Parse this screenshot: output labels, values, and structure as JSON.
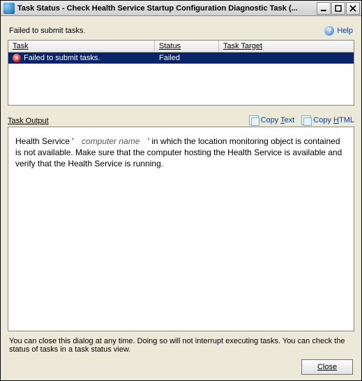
{
  "window": {
    "title": "Task Status - Check Health Service Startup Configuration Diagnostic Task (..."
  },
  "status_message": "Failed to submit tasks.",
  "help": {
    "label": "Help"
  },
  "table": {
    "columns": {
      "task": "Task",
      "status": "Status",
      "target": "Task Target"
    },
    "rows": [
      {
        "task": "Failed to submit tasks.",
        "status": "Failed",
        "target": ""
      }
    ]
  },
  "output": {
    "label": "Task Output",
    "copy_text_prefix": "Copy ",
    "copy_text_u": "T",
    "copy_text_suffix": "ext",
    "copy_html_prefix": "Copy ",
    "copy_html_u": "H",
    "copy_html_suffix": "TML",
    "msg_prefix": "Health Service '",
    "msg_placeholder": "computer name",
    "msg_suffix": "' in which the location monitoring object is contained is not available. Make sure that the computer hosting the Health Service is available and verify that the Health Service is running."
  },
  "footer_note": "You can close this dialog at any time.  Doing so will not interrupt executing tasks.  You can check the status of tasks in a task status view.",
  "buttons": {
    "close": "Close"
  }
}
